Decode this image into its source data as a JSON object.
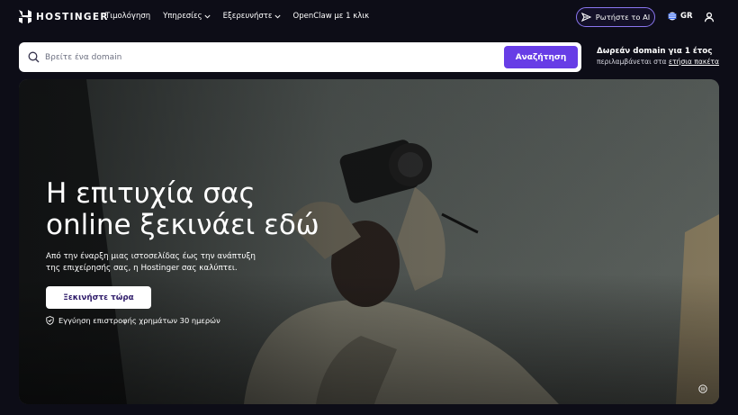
{
  "brand": {
    "name": "HOSTINGER"
  },
  "nav": {
    "links": [
      {
        "label": "Τιμολόγηση",
        "dropdown": false
      },
      {
        "label": "Υπηρεσίες",
        "dropdown": true
      },
      {
        "label": "Εξερευνήστε",
        "dropdown": true
      },
      {
        "label": "OpenClaw με 1 κλικ",
        "dropdown": false
      }
    ],
    "ai_button": "Ρωτήστε το AI",
    "language": "GR"
  },
  "search": {
    "placeholder": "Βρείτε ένα domain",
    "button": "Αναζήτηση"
  },
  "promo": {
    "title": "Δωρεάν domain για 1 έτος",
    "text": "περιλαμβάνεται στα",
    "link": "ετήσια πακέτα"
  },
  "hero": {
    "title_line1": "Η επιτυχία σας",
    "title_line2": "online ξεκινάει εδώ",
    "description": "Από την έναρξη μιας ιστοσελίδας έως την ανάπτυξη της επιχείρησής σας, η Hostinger σας καλύπτει.",
    "cta": "Ξεκινήστε τώρα",
    "guarantee": "Εγγύηση επιστροφής χρημάτων 30 ημερών"
  },
  "colors": {
    "background": "#0d0d17",
    "primary": "#673de6",
    "ai_border": "#8a76f0",
    "text_dark": "#2f1c6a"
  },
  "icons": [
    "hostinger-logo-icon",
    "chevron-down-icon",
    "sparkle-icon",
    "globe-icon",
    "user-icon",
    "search-icon",
    "shield-check-icon",
    "pause-icon"
  ]
}
